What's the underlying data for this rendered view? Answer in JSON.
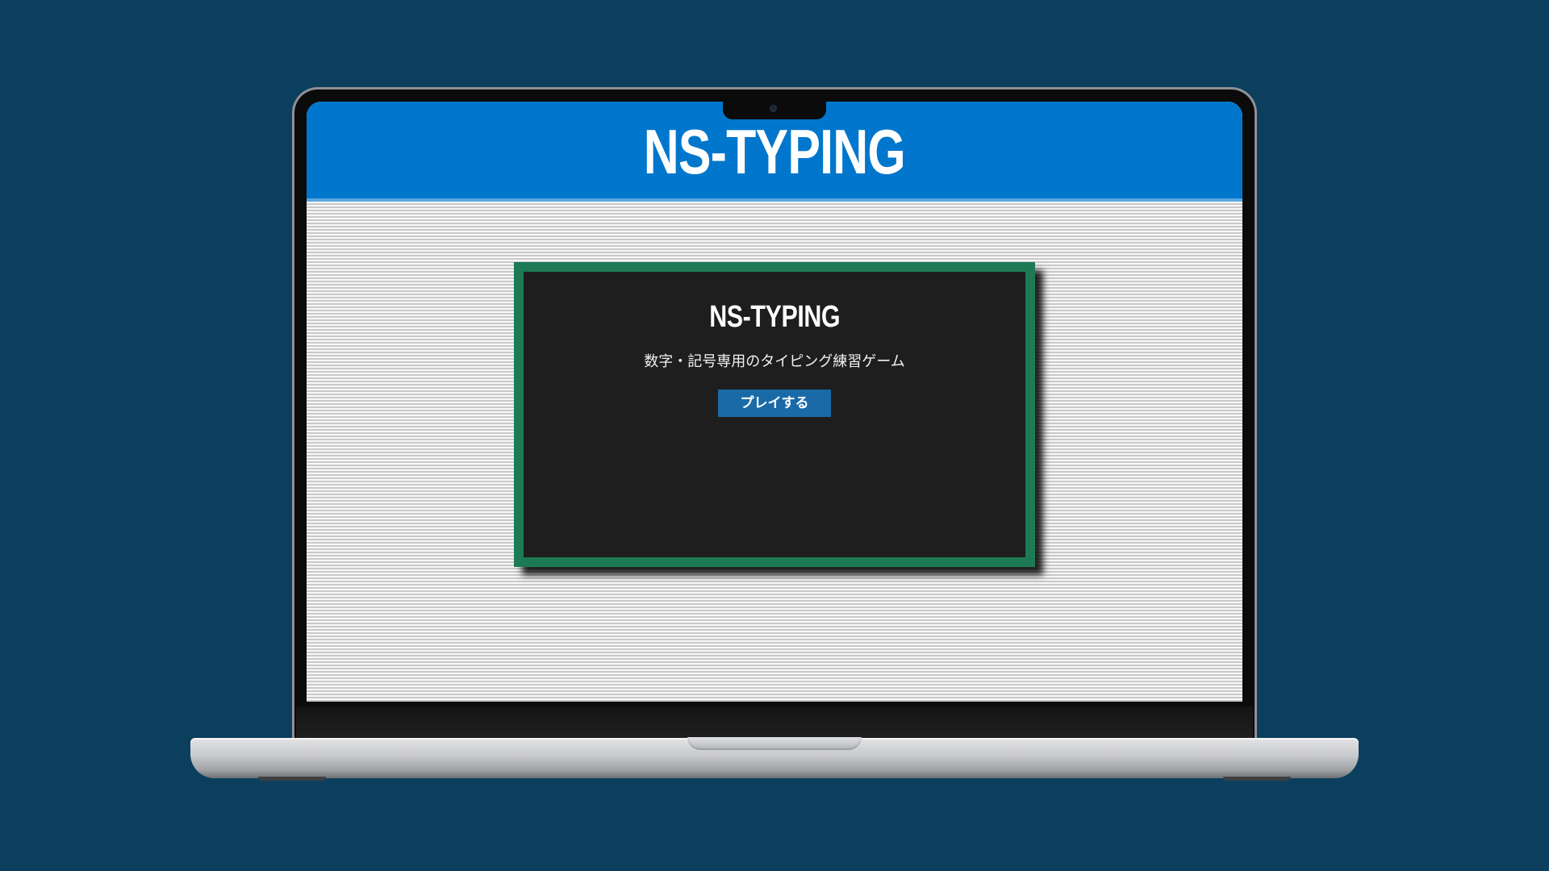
{
  "header": {
    "title": "NS-TYPING"
  },
  "game": {
    "title": "NS-TYPING",
    "subtitle": "数字・記号専用のタイピング練習ゲーム",
    "play_label": "プレイする"
  },
  "colors": {
    "background": "#0c3f5e",
    "header_blue": "#0077cc",
    "panel_border_green": "#1d7a55",
    "panel_dark": "#1e1e1e",
    "button_blue": "#1a6aa8"
  }
}
